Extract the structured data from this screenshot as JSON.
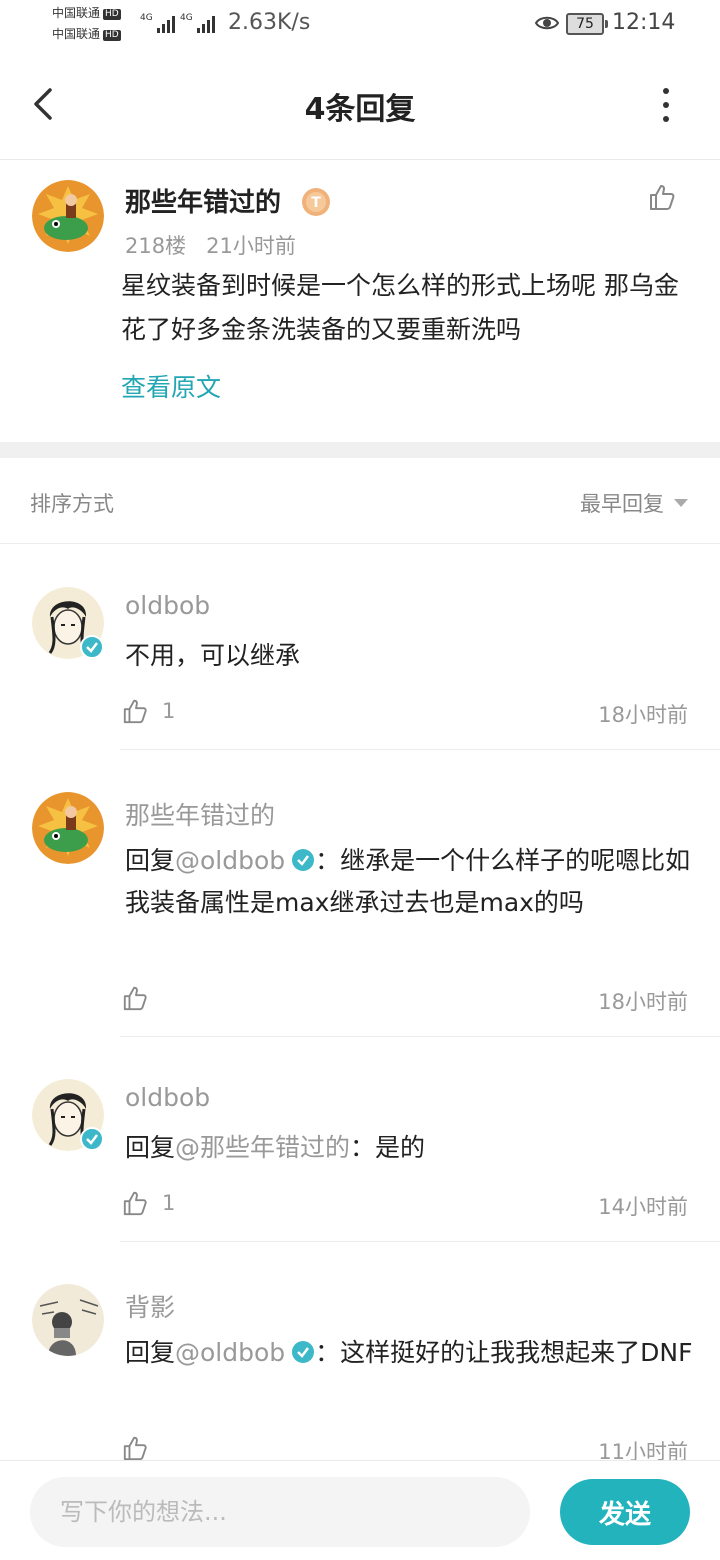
{
  "status_bar": {
    "carrier_1": "中国联通",
    "carrier_2": "中国联通",
    "hd_badge": "HD",
    "network_type": "4G",
    "net_speed": "2.63K/s",
    "battery": "75",
    "time": "12:14"
  },
  "header": {
    "title": "4条回复"
  },
  "original_post": {
    "author": "那些年错过的",
    "floor": "218楼",
    "time": "21小时前",
    "body": "星纹装备到时候是一个怎么样的形式上场呢 那乌金花了好多金条洗装备的又要重新洗吗",
    "view_original": "查看原文",
    "level_icon": "level-badge-icon"
  },
  "sort": {
    "label": "排序方式",
    "value": "最早回复"
  },
  "replies": [
    {
      "author": "oldbob",
      "text": "不用，可以继承",
      "likes": "1",
      "time": "18小时前"
    },
    {
      "author": "那些年错过的",
      "prefix": "回复",
      "mention": "@oldbob",
      "text": "：继承是一个什么样子的呢嗯比如我装备属性是max继承过去也是max的吗",
      "likes": "",
      "time": "18小时前"
    },
    {
      "author": "oldbob",
      "prefix": "回复",
      "mention": "@那些年错过的",
      "text": "：是的",
      "likes": "1",
      "time": "14小时前"
    },
    {
      "author": "背影",
      "prefix": "回复",
      "mention": "@oldbob",
      "text": "：这样挺好的让我我想起来了DNF",
      "likes": "",
      "time": "11小时前"
    }
  ],
  "composer": {
    "placeholder": "写下你的想法...",
    "send_label": "发送"
  },
  "colors": {
    "accent": "#22b3bd",
    "link": "#22a6b3",
    "verified": "#3cb8c8"
  }
}
